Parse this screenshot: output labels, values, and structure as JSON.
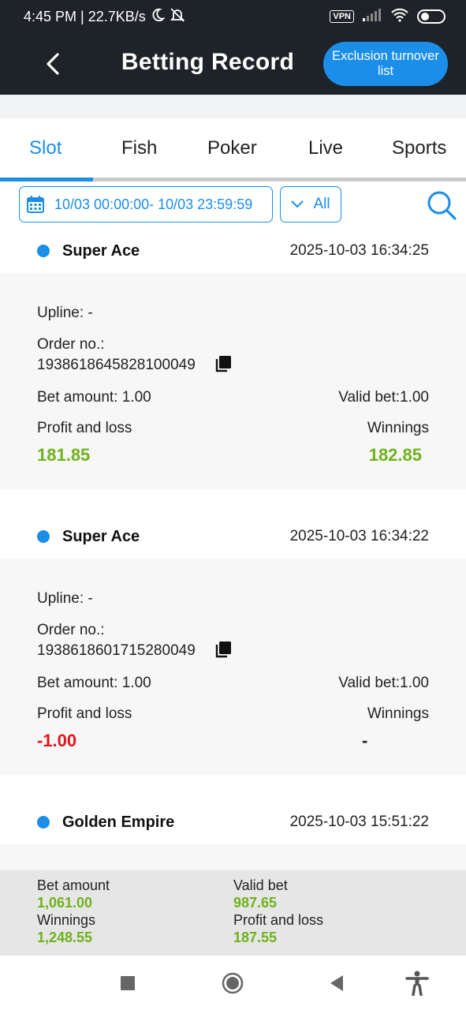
{
  "status_bar": {
    "time_speed": "4:45 PM | 22.7KB/s",
    "vpn": "VPN"
  },
  "header": {
    "title": "Betting Record",
    "exclusion_button": "Exclusion turnover list"
  },
  "tabs": [
    {
      "label": "Slot",
      "active": true
    },
    {
      "label": "Fish",
      "active": false
    },
    {
      "label": "Poker",
      "active": false
    },
    {
      "label": "Live",
      "active": false
    },
    {
      "label": "Sports",
      "active": false
    }
  ],
  "filter": {
    "date_range": "10/03 00:00:00- 10/03 23:59:59",
    "type_select": "All"
  },
  "records": [
    {
      "game": "Super Ace",
      "time": "2025-10-03 16:34:25",
      "upline": "Upline: -",
      "order_label": "Order no.:",
      "order_no": "1938618645828100049",
      "bet_amount": "Bet amount: 1.00",
      "valid_bet": "Valid bet:1.00",
      "pl_label": "Profit and loss",
      "winnings_label": "Winnings",
      "pl_value": "181.85",
      "winnings_value": "182.85"
    },
    {
      "game": "Super Ace",
      "time": "2025-10-03 16:34:22",
      "upline": "Upline: -",
      "order_label": "Order no.:",
      "order_no": "1938618601715280049",
      "bet_amount": "Bet amount: 1.00",
      "valid_bet": "Valid bet:1.00",
      "pl_label": "Profit and loss",
      "winnings_label": "Winnings",
      "pl_value": "-1.00",
      "winnings_value": "-"
    },
    {
      "game": "Golden Empire",
      "time": "2025-10-03 15:51:22"
    }
  ],
  "summary": {
    "bet_amount_label": "Bet amount",
    "bet_amount_value": "1,061.00",
    "valid_bet_label": "Valid bet",
    "valid_bet_value": "987.65",
    "winnings_label": "Winnings",
    "winnings_value": "1,248.55",
    "pl_label": "Profit and loss",
    "pl_value": "187.55"
  },
  "colors": {
    "accent": "#1a8ee8",
    "header_bg": "#1e2329",
    "positive": "#6fb21c",
    "negative": "#e3141a"
  },
  "icons": [
    "back-arrow-icon",
    "calendar-icon",
    "chevron-down-icon",
    "search-icon",
    "copy-icon",
    "recents-icon",
    "home-icon",
    "back-nav-icon",
    "accessibility-icon"
  ]
}
